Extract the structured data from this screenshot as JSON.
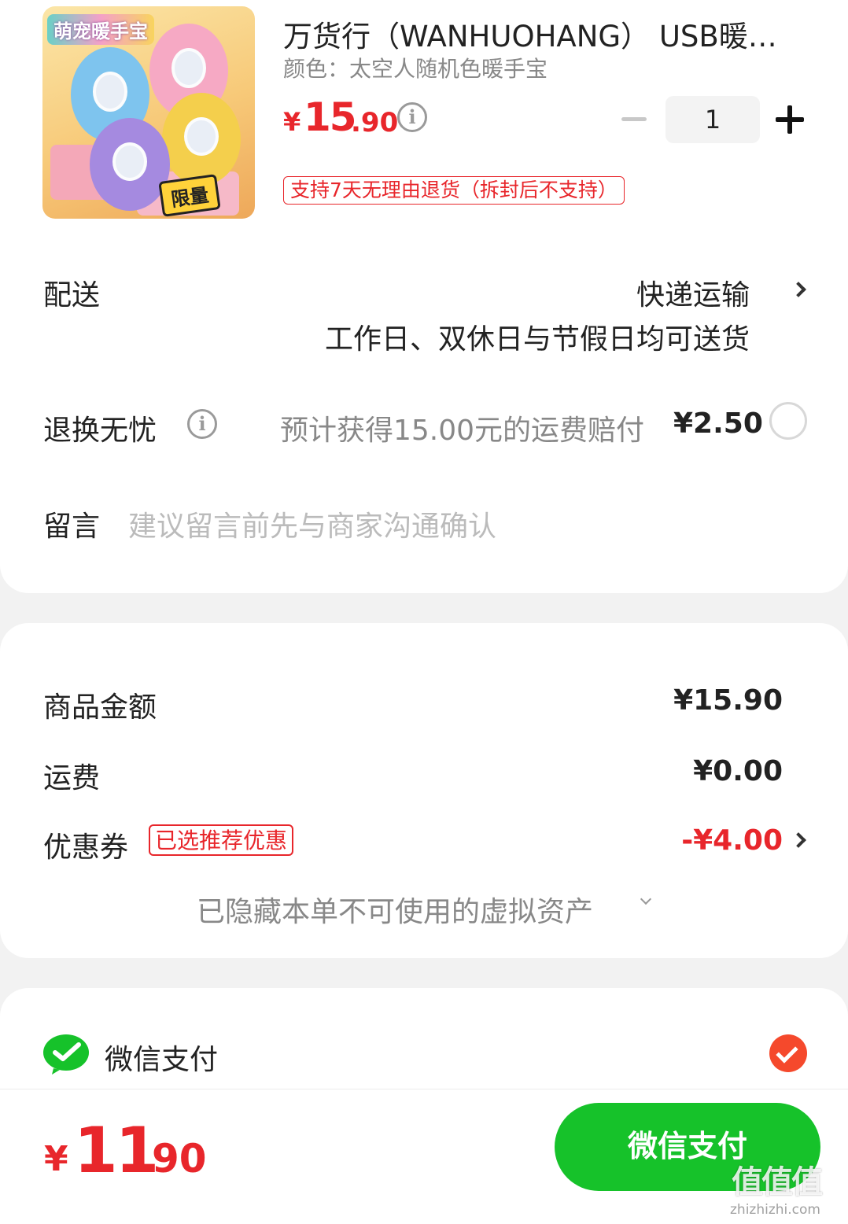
{
  "product": {
    "image_badge": "萌宠暖手宝",
    "image_limit_tag": "限量",
    "title": "万货行（WANHUOHANG） USB暖手宝",
    "variant": "颜色：太空人随机色暖手宝",
    "price_symbol": "¥",
    "price_int": "15",
    "price_dec": ".90",
    "info_icon": "i",
    "quantity": "1",
    "return_policy": "支持7天无理由退货（拆封后不支持）"
  },
  "delivery": {
    "label": "配送",
    "method": "快递运输",
    "schedule": "工作日、双休日与节假日均可送货"
  },
  "return_insurance": {
    "label": "退换无忧",
    "info_icon": "i",
    "desc": "预计获得15.00元的运费赔付",
    "price": "¥2.50"
  },
  "message": {
    "label": "留言",
    "placeholder": "建议留言前先与商家沟通确认"
  },
  "summary": {
    "goods_label": "商品金额",
    "goods_value": "¥15.90",
    "shipping_label": "运费",
    "shipping_value": "¥0.00",
    "coupon_label": "优惠券",
    "coupon_tag": "已选推荐优惠",
    "coupon_value": "-¥4.00",
    "hidden_assets": "已隐藏本单不可使用的虚拟资产"
  },
  "payment": {
    "method_label": "微信支付"
  },
  "footer": {
    "total_symbol": "¥",
    "total_int": "11",
    "total_dec": ".90",
    "pay_button": "微信支付",
    "watermark": "值值值",
    "watermark_url": "zhizhizhi.com"
  },
  "colors": {
    "accent_red": "#e8262b",
    "pay_green": "#16c22a",
    "check_orange": "#f5492c"
  }
}
